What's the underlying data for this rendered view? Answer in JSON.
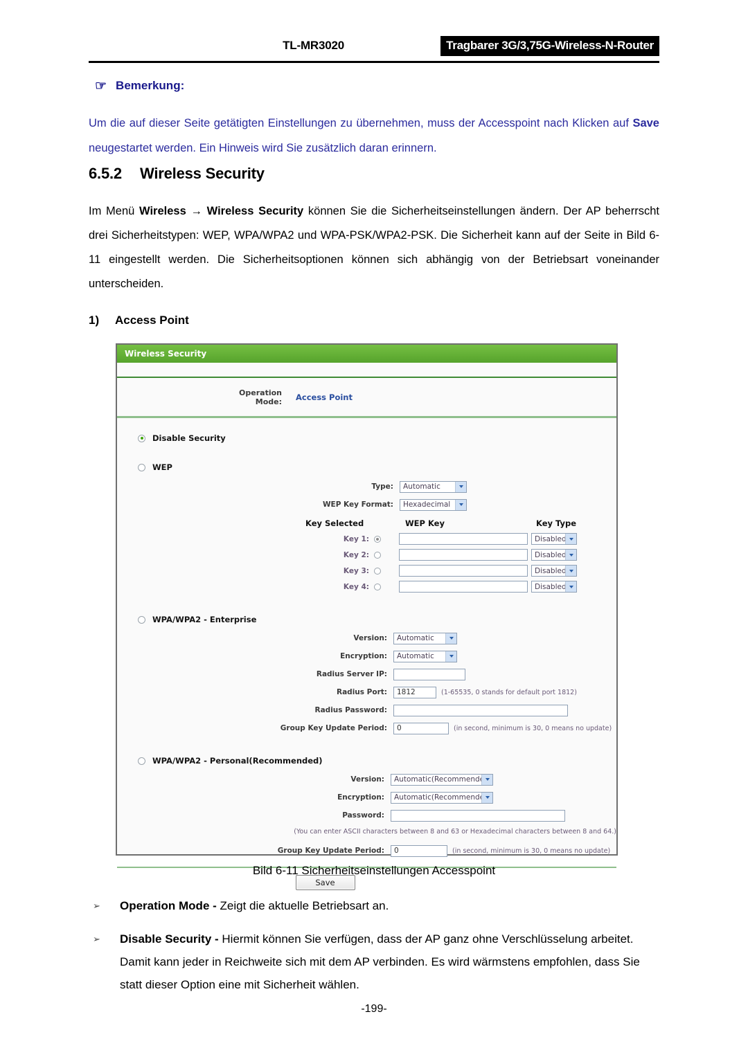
{
  "header": {
    "model": "TL-MR3020",
    "product_badge": "Tragbarer 3G/3,75G-Wireless-N-Router"
  },
  "note": {
    "icon": "pointing-hand-icon",
    "title": "Bemerkung:",
    "text_part1": "Um die auf dieser Seite getätigten Einstellungen zu übernehmen, muss der Accesspoint nach Klicken auf ",
    "text_bold": "Save",
    "text_part2": " neugestartet werden. Ein Hinweis wird Sie zusätzlich daran erinnern.",
    "accent_color": "#2b2b9e"
  },
  "section": {
    "number": "6.5.2",
    "title": "Wireless Security",
    "paragraph_1": "Im Menü ",
    "paragraph_bold_1": "Wireless",
    "paragraph_arrow": " → ",
    "paragraph_bold_2": "Wireless Security",
    "paragraph_2": " können Sie die Sicherheitseinstellungen ändern. Der AP beherrscht drei Sicherheitstypen: WEP, WPA/WPA2 und WPA-PSK/WPA2-PSK. Die Sicherheit kann auf der Seite in Bild 6-11 eingestellt werden. Die Sicherheitsoptionen können sich abhängig von der Betriebsart voneinander unterscheiden.",
    "subheading_number": "1)",
    "subheading_label": "Access Point"
  },
  "panel": {
    "title": "Wireless Security",
    "title_bg": "#5fb033",
    "operation_mode_label": "Operation Mode:",
    "operation_mode_value": "Access Point",
    "operation_mode_value_color": "#2b4fa0",
    "options": {
      "disable_security": "Disable Security",
      "wep": "WEP",
      "wpa_enterprise": "WPA/WPA2 - Enterprise",
      "wpa_personal": "WPA/WPA2 - Personal(Recommended)"
    },
    "wep": {
      "type_label": "Type:",
      "type_value": "Automatic",
      "key_format_label": "WEP Key Format:",
      "key_format_value": "Hexadecimal",
      "col_key_selected": "Key Selected",
      "col_wep_key": "WEP Key",
      "col_key_type": "Key Type",
      "keys": [
        {
          "label": "Key 1:",
          "value": "",
          "key_type": "Disabled",
          "selected": true
        },
        {
          "label": "Key 2:",
          "value": "",
          "key_type": "Disabled",
          "selected": false
        },
        {
          "label": "Key 3:",
          "value": "",
          "key_type": "Disabled",
          "selected": false
        },
        {
          "label": "Key 4:",
          "value": "",
          "key_type": "Disabled",
          "selected": false
        }
      ]
    },
    "enterprise": {
      "version_label": "Version:",
      "version_value": "Automatic",
      "encryption_label": "Encryption:",
      "encryption_value": "Automatic",
      "radius_ip_label": "Radius Server IP:",
      "radius_ip_value": "",
      "radius_port_label": "Radius Port:",
      "radius_port_value": "1812",
      "radius_port_hint": "(1-65535, 0 stands for default port 1812)",
      "radius_password_label": "Radius Password:",
      "radius_password_value": "",
      "group_key_label": "Group Key Update Period:",
      "group_key_value": "0",
      "group_key_hint": "(in second, minimum is 30, 0 means no update)"
    },
    "personal": {
      "version_label": "Version:",
      "version_value": "Automatic(Recommended)",
      "encryption_label": "Encryption:",
      "encryption_value": "Automatic(Recommended)",
      "password_label": "Password:",
      "password_value": "",
      "password_hint": "(You can enter ASCII characters between 8 and 63 or Hexadecimal characters between 8 and 64.)",
      "group_key_label": "Group Key Update Period:",
      "group_key_value": "0",
      "group_key_hint": "(in second, minimum is 30, 0 means no update)"
    },
    "save_button": "Save"
  },
  "caption": "Bild 6-11 Sicherheitseinstellungen Accesspoint",
  "bullets": [
    {
      "mark": "➢",
      "bold": "Operation Mode - ",
      "text": "Zeigt die aktuelle Betriebsart an."
    },
    {
      "mark": "➢",
      "bold": "Disable Security - ",
      "text": "Hiermit können Sie verfügen, dass der AP ganz ohne Verschlüsselung arbeitet. Damit kann jeder in Reichweite sich mit dem AP verbinden. Es wird wärmstens empfohlen, dass Sie statt dieser Option eine mit Sicherheit wählen."
    }
  ],
  "footer": "-199-"
}
